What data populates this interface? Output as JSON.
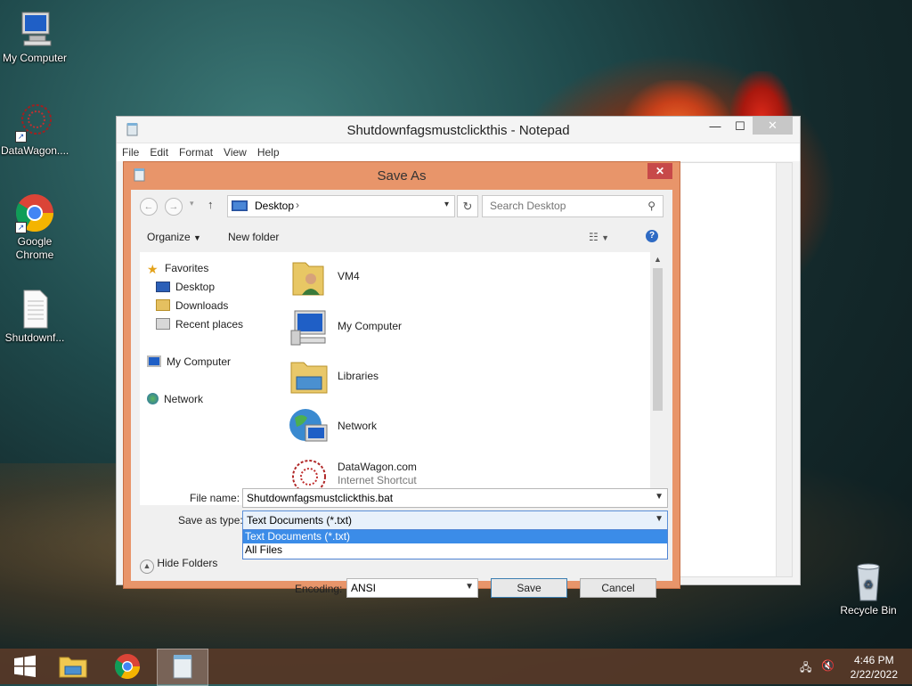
{
  "desktop": {
    "icons": [
      {
        "label": "My Computer",
        "icon": "computer-icon"
      },
      {
        "label": "DataWagon....",
        "icon": "datawagon-icon"
      },
      {
        "label": "Google Chrome",
        "icon": "chrome-icon"
      },
      {
        "label": "Shutdownf...",
        "icon": "text-file-icon"
      },
      {
        "label": "Recycle Bin",
        "icon": "recycle-bin-icon"
      }
    ]
  },
  "notepad": {
    "title": "Shutdownfagsmustclickthis - Notepad",
    "menu": [
      "File",
      "Edit",
      "Format",
      "View",
      "Help"
    ],
    "controls": {
      "minimize": "—",
      "maximize": "☐",
      "close": "✕"
    }
  },
  "save_dialog": {
    "title": "Save As",
    "close": "✕",
    "address": {
      "location": "Desktop",
      "chevron": "›"
    },
    "search_placeholder": "Search Desktop",
    "toolbar": {
      "organize": "Organize",
      "new_folder": "New folder"
    },
    "tree": {
      "favorites": "Favorites",
      "desktop": "Desktop",
      "downloads": "Downloads",
      "recent_places": "Recent places",
      "my_computer": "My Computer",
      "network": "Network"
    },
    "files": [
      {
        "name": "VM4",
        "icon": "user-folder-icon"
      },
      {
        "name": "My Computer",
        "icon": "computer-icon"
      },
      {
        "name": "Libraries",
        "icon": "libraries-icon"
      },
      {
        "name": "Network",
        "icon": "network-icon"
      },
      {
        "name": "DataWagon.com",
        "sub": "Internet Shortcut",
        "icon": "datawagon-icon"
      }
    ],
    "file_name_label": "File name:",
    "file_name_value": "Shutdownfagsmustclickthis.bat",
    "save_type_label": "Save as type:",
    "save_type_value": "Text Documents (*.txt)",
    "type_options": [
      "Text Documents (*.txt)",
      "All Files"
    ],
    "hide_folders": "Hide Folders",
    "encoding_label": "Encoding:",
    "encoding_value": "ANSI",
    "save_button": "Save",
    "cancel_button": "Cancel"
  },
  "taskbar": {
    "time": "4:46 PM",
    "date": "2/22/2022"
  },
  "colors": {
    "dialog_frame": "#e8956a",
    "selection": "#3b8ce8",
    "taskbar": "#583a28"
  }
}
